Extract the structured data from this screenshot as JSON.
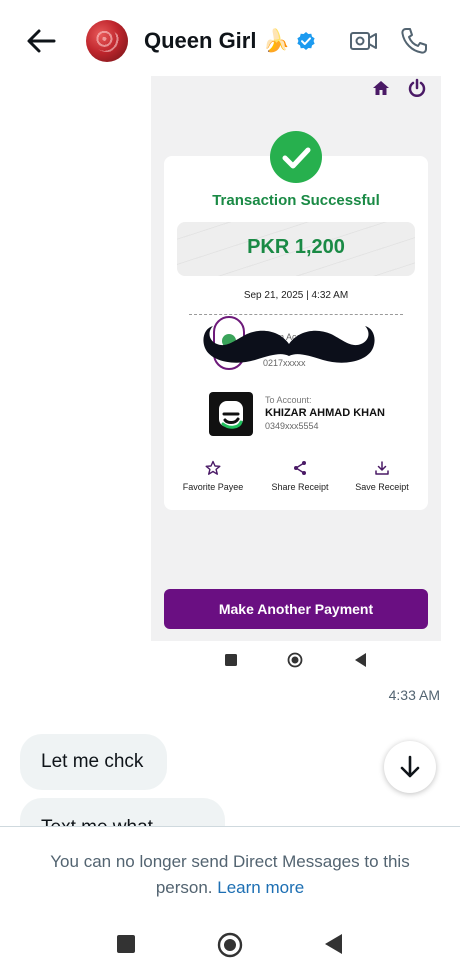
{
  "header": {
    "contact_name": "Queen Girl 🍌",
    "icons": [
      "back-arrow-icon",
      "avatar",
      "verified-badge-icon",
      "video-call-icon",
      "phone-call-icon"
    ]
  },
  "receipt": {
    "title": "Transaction Successful",
    "amount": "PKR 1,200",
    "datetime": "Sep 21, 2025 | 4:32 AM",
    "from_label": "From Account",
    "from_account": "0217xxxxx",
    "to_label": "To Account:",
    "to_name": "KHIZAR AHMAD KHAN",
    "to_account": "0349xxx5554",
    "actions": [
      "Favorite Payee",
      "Share Receipt",
      "Save Receipt"
    ],
    "primary_button": "Make Another Payment",
    "colors": {
      "success": "#1a8a45",
      "brand": "#6a0f82"
    }
  },
  "messages": {
    "image_time": "4:33 AM",
    "bubbles": [
      "Let me chck",
      "Text me what"
    ]
  },
  "footer": {
    "notice": "You can no longer send Direct Messages to this person.",
    "link": "Learn more"
  }
}
